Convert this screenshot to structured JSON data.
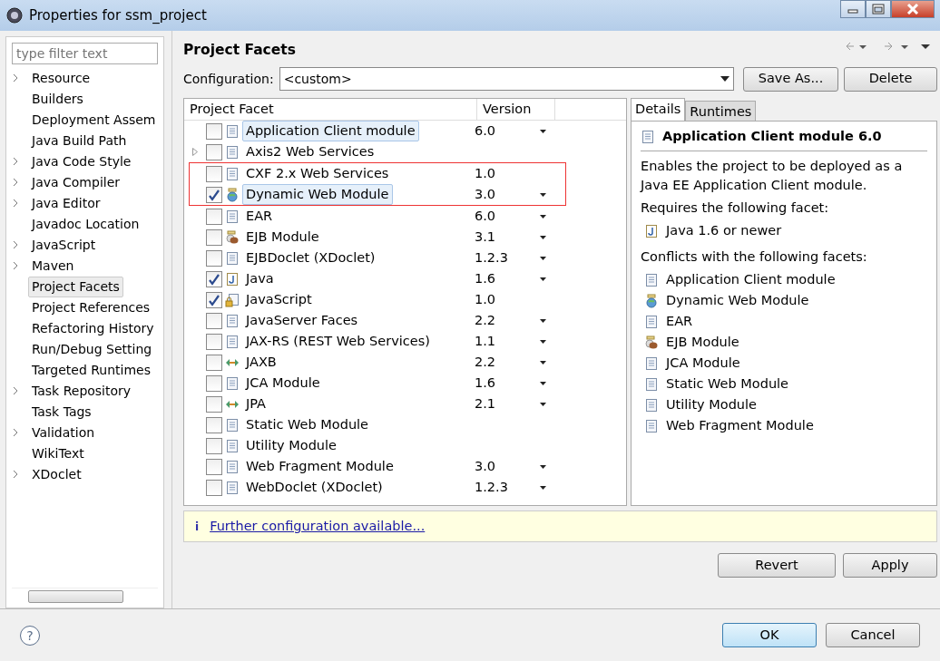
{
  "window": {
    "title": "Properties for ssm_project"
  },
  "filter": {
    "placeholder": "type filter text"
  },
  "sidebar": {
    "items": [
      {
        "label": "Resource",
        "expandable": true,
        "selected": false
      },
      {
        "label": "Builders",
        "expandable": false,
        "selected": false
      },
      {
        "label": "Deployment Assem",
        "expandable": false,
        "selected": false
      },
      {
        "label": "Java Build Path",
        "expandable": false,
        "selected": false
      },
      {
        "label": "Java Code Style",
        "expandable": true,
        "selected": false
      },
      {
        "label": "Java Compiler",
        "expandable": true,
        "selected": false
      },
      {
        "label": "Java Editor",
        "expandable": true,
        "selected": false
      },
      {
        "label": "Javadoc Location",
        "expandable": false,
        "selected": false
      },
      {
        "label": "JavaScript",
        "expandable": true,
        "selected": false
      },
      {
        "label": "Maven",
        "expandable": true,
        "selected": false
      },
      {
        "label": "Project Facets",
        "expandable": false,
        "selected": true
      },
      {
        "label": "Project References",
        "expandable": false,
        "selected": false
      },
      {
        "label": "Refactoring History",
        "expandable": false,
        "selected": false
      },
      {
        "label": "Run/Debug Setting",
        "expandable": false,
        "selected": false
      },
      {
        "label": "Targeted Runtimes",
        "expandable": false,
        "selected": false
      },
      {
        "label": "Task Repository",
        "expandable": true,
        "selected": false
      },
      {
        "label": "Task Tags",
        "expandable": false,
        "selected": false
      },
      {
        "label": "Validation",
        "expandable": true,
        "selected": false
      },
      {
        "label": "WikiText",
        "expandable": false,
        "selected": false
      },
      {
        "label": "XDoclet",
        "expandable": true,
        "selected": false
      }
    ]
  },
  "page": {
    "title": "Project Facets",
    "configuration_label": "Configuration:",
    "configuration_value": "<custom>",
    "buttons": [
      "Save As...",
      "Delete"
    ]
  },
  "table": {
    "columns": [
      "Project Facet",
      "Version"
    ],
    "rows": [
      {
        "name": "Application Client module",
        "version": "6.0",
        "dropdown": true,
        "checked": false,
        "selected": true,
        "expandable": false,
        "boxed": false,
        "kind": "page"
      },
      {
        "name": "Axis2 Web Services",
        "dropdown": false,
        "checked": false,
        "selected": false,
        "expandable": true,
        "boxed": false,
        "kind": "page"
      },
      {
        "name": "CXF 2.x Web Services",
        "version": "1.0",
        "dropdown": false,
        "checked": false,
        "selected": false,
        "expandable": false,
        "boxed": true,
        "kind": "page"
      },
      {
        "name": "Dynamic Web Module",
        "version": "3.0",
        "dropdown": true,
        "checked": true,
        "selected": true,
        "expandable": false,
        "boxed": true,
        "kind": "web"
      },
      {
        "name": "EAR",
        "version": "6.0",
        "dropdown": true,
        "checked": false,
        "selected": false,
        "expandable": false,
        "boxed": false,
        "kind": "page"
      },
      {
        "name": "EJB Module",
        "version": "3.1",
        "dropdown": true,
        "checked": false,
        "selected": false,
        "expandable": false,
        "boxed": false,
        "kind": "bean"
      },
      {
        "name": "EJBDoclet (XDoclet)",
        "version": "1.2.3",
        "dropdown": true,
        "checked": false,
        "selected": false,
        "expandable": false,
        "boxed": false,
        "kind": "page"
      },
      {
        "name": "Java",
        "version": "1.6",
        "dropdown": true,
        "checked": true,
        "selected": false,
        "expandable": false,
        "boxed": false,
        "kind": "java"
      },
      {
        "name": "JavaScript",
        "version": "1.0",
        "dropdown": false,
        "checked": true,
        "selected": false,
        "expandable": false,
        "boxed": false,
        "kind": "locked"
      },
      {
        "name": "JavaServer Faces",
        "version": "2.2",
        "dropdown": true,
        "checked": false,
        "selected": false,
        "expandable": false,
        "boxed": false,
        "kind": "page"
      },
      {
        "name": "JAX-RS (REST Web Services)",
        "version": "1.1",
        "dropdown": true,
        "checked": false,
        "selected": false,
        "expandable": false,
        "boxed": false,
        "kind": "page"
      },
      {
        "name": "JAXB",
        "version": "2.2",
        "dropdown": true,
        "checked": false,
        "selected": false,
        "expandable": false,
        "boxed": false,
        "kind": "arrows"
      },
      {
        "name": "JCA Module",
        "version": "1.6",
        "dropdown": true,
        "checked": false,
        "selected": false,
        "expandable": false,
        "boxed": false,
        "kind": "page"
      },
      {
        "name": "JPA",
        "version": "2.1",
        "dropdown": true,
        "checked": false,
        "selected": false,
        "expandable": false,
        "boxed": false,
        "kind": "arrows"
      },
      {
        "name": "Static Web Module",
        "dropdown": false,
        "checked": false,
        "selected": false,
        "expandable": false,
        "boxed": false,
        "kind": "page"
      },
      {
        "name": "Utility Module",
        "dropdown": false,
        "checked": false,
        "selected": false,
        "expandable": false,
        "boxed": false,
        "kind": "page"
      },
      {
        "name": "Web Fragment Module",
        "version": "3.0",
        "dropdown": true,
        "checked": false,
        "selected": false,
        "expandable": false,
        "boxed": false,
        "kind": "page"
      },
      {
        "name": "WebDoclet (XDoclet)",
        "version": "1.2.3",
        "dropdown": true,
        "checked": false,
        "selected": false,
        "expandable": false,
        "boxed": false,
        "kind": "page"
      }
    ]
  },
  "details": {
    "tabs": [
      {
        "label": "Details",
        "selected": true
      },
      {
        "label": "Runtimes",
        "selected": false
      }
    ],
    "title": "Application Client module 6.0",
    "description": "Enables the project to be deployed as a Java EE Application Client module.",
    "requires_label": "Requires the following facet:",
    "requires": [
      {
        "name": "Java 1.6 or newer",
        "kind": "java"
      }
    ],
    "conflicts_label": "Conflicts with the following facets:",
    "conflicts": [
      {
        "name": "Application Client module",
        "kind": "page"
      },
      {
        "name": "Dynamic Web Module",
        "kind": "web"
      },
      {
        "name": "EAR",
        "kind": "page"
      },
      {
        "name": "EJB Module",
        "kind": "bean"
      },
      {
        "name": "JCA Module",
        "kind": "page"
      },
      {
        "name": "Static Web Module",
        "kind": "page"
      },
      {
        "name": "Utility Module",
        "kind": "page"
      },
      {
        "name": "Web Fragment Module",
        "kind": "page"
      }
    ]
  },
  "info": {
    "icon": "i",
    "link": "Further configuration available..."
  },
  "page_buttons": [
    "Revert",
    "Apply"
  ],
  "help": "?",
  "dialog_buttons": [
    {
      "label": "OK",
      "default": true
    },
    {
      "label": "Cancel",
      "default": false
    }
  ]
}
